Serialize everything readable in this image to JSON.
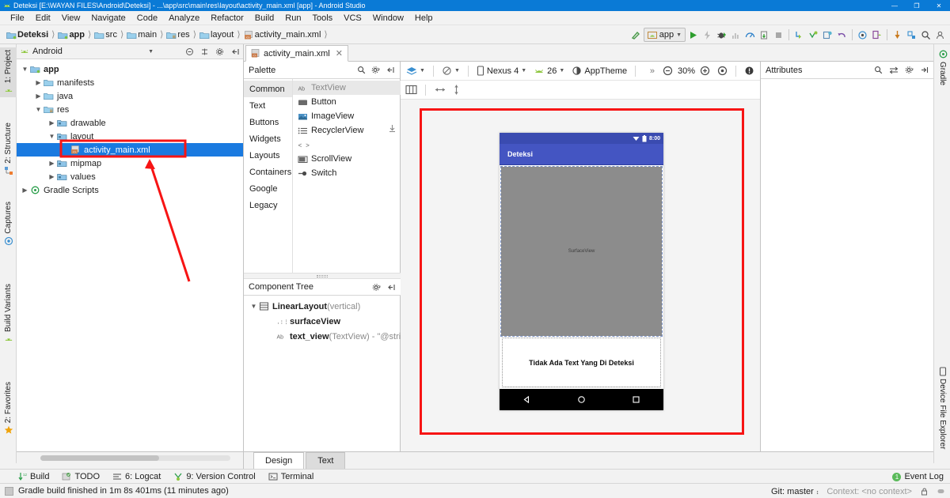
{
  "window": {
    "title": "Deteksi [E:\\WAYAN FILES\\Android\\Deteksi] - ...\\app\\src\\main\\res\\layout\\activity_main.xml [app] - Android Studio",
    "minimize": "—",
    "maximize": "❐",
    "close": "✕"
  },
  "menu": [
    "File",
    "Edit",
    "View",
    "Navigate",
    "Code",
    "Analyze",
    "Refactor",
    "Build",
    "Run",
    "Tools",
    "VCS",
    "Window",
    "Help"
  ],
  "breadcrumbs": [
    {
      "label": "Deteksi",
      "icon": "module-icon",
      "bold": true
    },
    {
      "label": "app",
      "icon": "folder-module-icon",
      "bold": true
    },
    {
      "label": "src",
      "icon": "folder-icon",
      "bold": false
    },
    {
      "label": "main",
      "icon": "folder-icon",
      "bold": false
    },
    {
      "label": "res",
      "icon": "folder-res-icon",
      "bold": false
    },
    {
      "label": "layout",
      "icon": "folder-icon",
      "bold": false
    },
    {
      "label": "activity_main.xml",
      "icon": "xml-layout-icon",
      "bold": false
    }
  ],
  "toolbar": {
    "run_config": "app",
    "icons": [
      "build-icon",
      "run-icon",
      "apply-changes-icon",
      "debug-icon",
      "profile-icon",
      "monitor-icon",
      "stop-icon-a",
      "stop-icon",
      "sync-icon",
      "avd-manager-icon",
      "sdk-manager-icon",
      "undo-icon",
      "layout-inspector-icon",
      "device-manager-icon",
      "profiler-icon",
      "attach-debugger-icon",
      "search-icon",
      "user-icon"
    ]
  },
  "left_tool_tabs": [
    {
      "label": "1: Project",
      "icon": "project-icon",
      "active": true
    },
    {
      "label": "2: Structure",
      "icon": "structure-icon",
      "active": false
    },
    {
      "label": "Captures",
      "icon": "captures-icon",
      "active": false
    },
    {
      "label": "Build Variants",
      "icon": "build-variants-icon",
      "active": false
    },
    {
      "label": "2: Favorites",
      "icon": "favorites-star-icon",
      "active": false
    }
  ],
  "right_tool_tabs": [
    {
      "label": "Gradle",
      "icon": "gradle-icon"
    },
    {
      "label": "Device File Explorer",
      "icon": "device-file-icon"
    }
  ],
  "project_panel": {
    "title": "Android",
    "header_icons": [
      "collapse-all-icon",
      "expand-all-icon",
      "settings-gear-icon",
      "hide-panel-icon"
    ],
    "tree": [
      {
        "label": "app",
        "depth": 0,
        "arrow": "down",
        "icon": "module-icon",
        "bold": true,
        "selected": false
      },
      {
        "label": "manifests",
        "depth": 1,
        "arrow": "right",
        "icon": "folder-icon",
        "bold": false,
        "selected": false
      },
      {
        "label": "java",
        "depth": 1,
        "arrow": "right",
        "icon": "folder-icon",
        "bold": false,
        "selected": false
      },
      {
        "label": "res",
        "depth": 1,
        "arrow": "down",
        "icon": "folder-res-icon",
        "bold": false,
        "selected": false
      },
      {
        "label": "drawable",
        "depth": 2,
        "arrow": "right",
        "icon": "folder-dark-icon",
        "bold": false,
        "selected": false
      },
      {
        "label": "layout",
        "depth": 2,
        "arrow": "down",
        "icon": "folder-dark-icon",
        "bold": false,
        "selected": false
      },
      {
        "label": "activity_main.xml",
        "depth": 3,
        "arrow": "none",
        "icon": "xml-layout-icon",
        "bold": false,
        "selected": true
      },
      {
        "label": "mipmap",
        "depth": 2,
        "arrow": "right",
        "icon": "folder-dark-icon",
        "bold": false,
        "selected": false
      },
      {
        "label": "values",
        "depth": 2,
        "arrow": "right",
        "icon": "folder-dark-icon",
        "bold": false,
        "selected": false
      },
      {
        "label": "Gradle Scripts",
        "depth": 0,
        "arrow": "right",
        "icon": "gradle-icon",
        "bold": false,
        "selected": false
      }
    ]
  },
  "editor_tab": {
    "label": "activity_main.xml",
    "icon": "xml-layout-icon",
    "close": "✕"
  },
  "palette": {
    "title": "Palette",
    "categories": [
      {
        "label": "Common",
        "active": true
      },
      {
        "label": "Text",
        "active": false
      },
      {
        "label": "Buttons",
        "active": false
      },
      {
        "label": "Widgets",
        "active": false
      },
      {
        "label": "Layouts",
        "active": false
      },
      {
        "label": "Containers",
        "active": false
      },
      {
        "label": "Google",
        "active": false
      },
      {
        "label": "Legacy",
        "active": false
      }
    ],
    "items": [
      {
        "label": "TextView",
        "icon": "textview-icon",
        "selected": true
      },
      {
        "label": "Button",
        "icon": "button-icon",
        "selected": false
      },
      {
        "label": "ImageView",
        "icon": "imageview-icon",
        "selected": false
      },
      {
        "label": "RecyclerView",
        "icon": "recyclerview-icon",
        "selected": false
      },
      {
        "label": "<fragment>",
        "icon": "fragment-icon",
        "selected": false
      },
      {
        "label": "ScrollView",
        "icon": "scrollview-icon",
        "selected": false
      },
      {
        "label": "Switch",
        "icon": "switch-icon",
        "selected": false
      }
    ]
  },
  "component_tree": {
    "title": "Component Tree",
    "rows": [
      {
        "name": "LinearLayout",
        "suffix": " (vertical)",
        "depth": 0,
        "arrow": "down",
        "icon": "linearlayout-icon"
      },
      {
        "name": "surfaceView",
        "suffix": "",
        "depth": 1,
        "arrow": "none",
        "icon": "surfaceview-icon"
      },
      {
        "name": "text_view",
        "suffix": " (TextView) - \"@stri",
        "depth": 1,
        "arrow": "none",
        "icon": "textview-icon"
      }
    ]
  },
  "design_toolbar": {
    "design_mode": "design-surface-icon",
    "orientation": "orientation-icon",
    "device": "Nexus 4",
    "api": "26",
    "theme": "AppTheme",
    "overflow": "»",
    "zoom_out": "−",
    "zoom_level": "30%",
    "zoom_in": "+",
    "zoom_fit": "◎",
    "issues": "!"
  },
  "design_toolbar2": {
    "icons": [
      "blueprint-columns-icon",
      "width-arrow-icon",
      "height-arrow-icon"
    ]
  },
  "preview": {
    "status_time": "8:00",
    "app_title": "Deteksi",
    "surface_label": "SurfaceView",
    "text_value": "Tidak Ada Text Yang Di Deteksi",
    "nav": [
      "back-nav-icon",
      "home-nav-icon",
      "recents-nav-icon"
    ],
    "appbar_color": "#4455c2",
    "statusbar_color": "#3a4bb0",
    "surface_color": "#8c8c8c",
    "annotation_color": "#f71414"
  },
  "attributes": {
    "title": "Attributes",
    "icons": [
      "search-icon",
      "swap-icon",
      "settings-gear-icon",
      "collapse-right-icon"
    ]
  },
  "design_tabs": [
    {
      "label": "Design",
      "active": true
    },
    {
      "label": "Text",
      "active": false
    }
  ],
  "bottom_bar": [
    {
      "label": "Build",
      "icon": "build-bottom-icon"
    },
    {
      "label": "TODO",
      "icon": "todo-icon"
    },
    {
      "label": "6: Logcat",
      "icon": "logcat-icon"
    },
    {
      "label": "9: Version Control",
      "icon": "vcs-icon"
    },
    {
      "label": "Terminal",
      "icon": "terminal-icon"
    }
  ],
  "event_log": {
    "label": "Event Log",
    "count": "1"
  },
  "status_bar": {
    "message": "Gradle build finished in 1m 8s 401ms (11 minutes ago)",
    "git_branch": "Git: master",
    "context": "Context: <no context>"
  }
}
